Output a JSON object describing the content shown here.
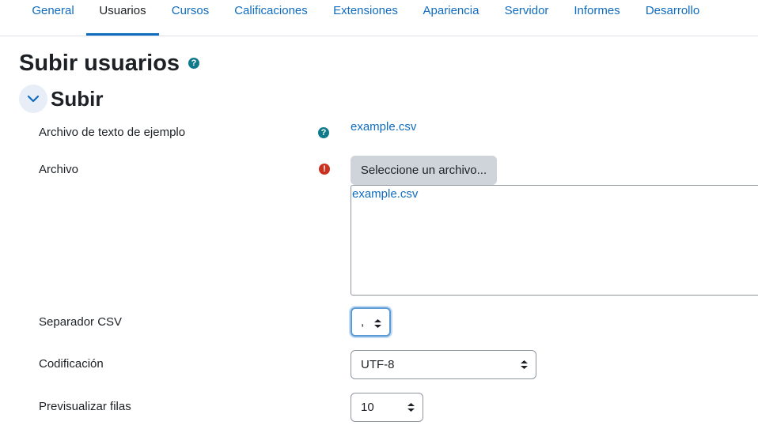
{
  "nav": {
    "tabs": [
      {
        "label": "General"
      },
      {
        "label": "Usuarios",
        "active": true
      },
      {
        "label": "Cursos"
      },
      {
        "label": "Calificaciones"
      },
      {
        "label": "Extensiones"
      },
      {
        "label": "Apariencia"
      },
      {
        "label": "Servidor"
      },
      {
        "label": "Informes"
      },
      {
        "label": "Desarrollo"
      }
    ]
  },
  "page": {
    "title": "Subir usuarios",
    "help_glyph": "?"
  },
  "section": {
    "title": "Subir",
    "collapse_glyph": "chevron-down-icon"
  },
  "form": {
    "example_file": {
      "label": "Archivo de texto de ejemplo",
      "help_glyph": "?",
      "link": "example.csv"
    },
    "file": {
      "label": "Archivo",
      "required_glyph": "!",
      "choose_button": "Seleccione un archivo...",
      "uploaded_file": "example.csv"
    },
    "csv_separator": {
      "label": "Separador CSV",
      "value": ","
    },
    "encoding": {
      "label": "Codificación",
      "value": "UTF-8"
    },
    "preview_rows": {
      "label": "Previsualizar filas",
      "value": "10"
    }
  },
  "colors": {
    "link": "#0f6cbf",
    "help_icon": "#0f7b8a",
    "required_icon": "#ca3120",
    "active_tab_underline": "#0f6cbf"
  }
}
